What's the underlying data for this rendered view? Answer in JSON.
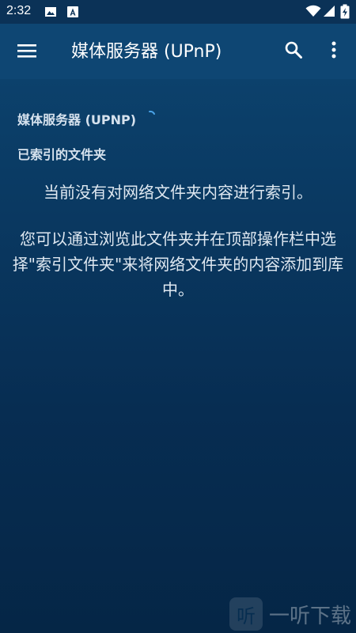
{
  "status_bar": {
    "time": "2:32",
    "icons": [
      "image-icon",
      "accessibility-icon",
      "wifi-icon",
      "signal-icon",
      "battery-icon"
    ]
  },
  "app_bar": {
    "title": "媒体服务器 (UPnP)",
    "icons": [
      "menu-icon",
      "search-icon",
      "more-vert-icon"
    ]
  },
  "content": {
    "server_label": "媒体服务器 (UPNP)",
    "indexed_label": "已索引的文件夹",
    "empty_message": "当前没有对网络文件夹内容进行索引。",
    "hint_message": "您可以通过浏览此文件夹并在顶部操作栏中选择\"索引文件夹\"来将网络文件夹的内容添加到库中。"
  },
  "watermark": {
    "badge": "听",
    "text": "一听下载"
  },
  "colors": {
    "app_bar": "#0e4673",
    "status_bar": "#0b3257",
    "background_top": "#0d4672",
    "background_bottom": "#052646",
    "accent": "#4aa3e8"
  }
}
